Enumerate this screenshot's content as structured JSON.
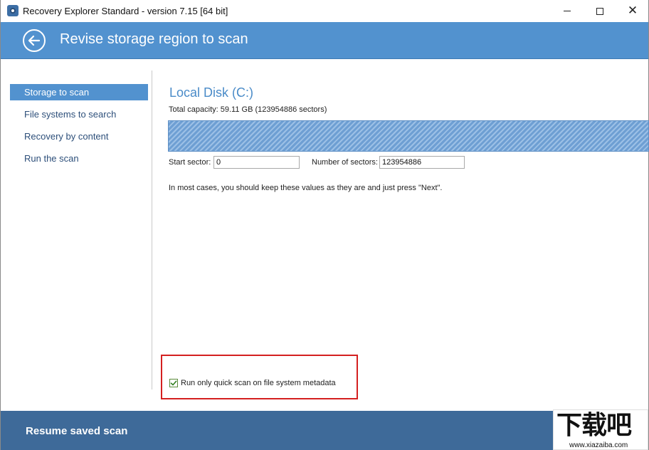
{
  "window": {
    "title": "Recovery Explorer Standard - version 7.15 [64 bit]",
    "icon": "app-logo-icon"
  },
  "header": {
    "title": "Revise storage region to scan",
    "back_icon": "back-arrow-icon"
  },
  "nav": {
    "items": [
      {
        "label": "Storage to scan",
        "active": true
      },
      {
        "label": "File systems to search",
        "active": false
      },
      {
        "label": "Recovery by content",
        "active": false
      },
      {
        "label": "Run the scan",
        "active": false
      }
    ]
  },
  "main": {
    "disk_name": "Local Disk (C:)",
    "capacity": "Total capacity: 59.11 GB (123954886 sectors)",
    "start_sector_label": "Start sector:",
    "start_sector_value": "0",
    "num_sectors_label": "Number of sectors:",
    "num_sectors_value": "123954886",
    "hint": "In most cases, you should keep these values as they are and just press \"Next\"."
  },
  "options": {
    "quick_scan_label": "Run only quick scan on file system metadata",
    "quick_scan_checked": true
  },
  "footer": {
    "resume_label": "Resume saved scan"
  },
  "watermark": {
    "logo_text": "下载吧",
    "url": "www.xiazaiba.com"
  },
  "colors": {
    "accent": "#5292cf",
    "footer": "#3e6a99",
    "highlight_border": "#d42020"
  }
}
